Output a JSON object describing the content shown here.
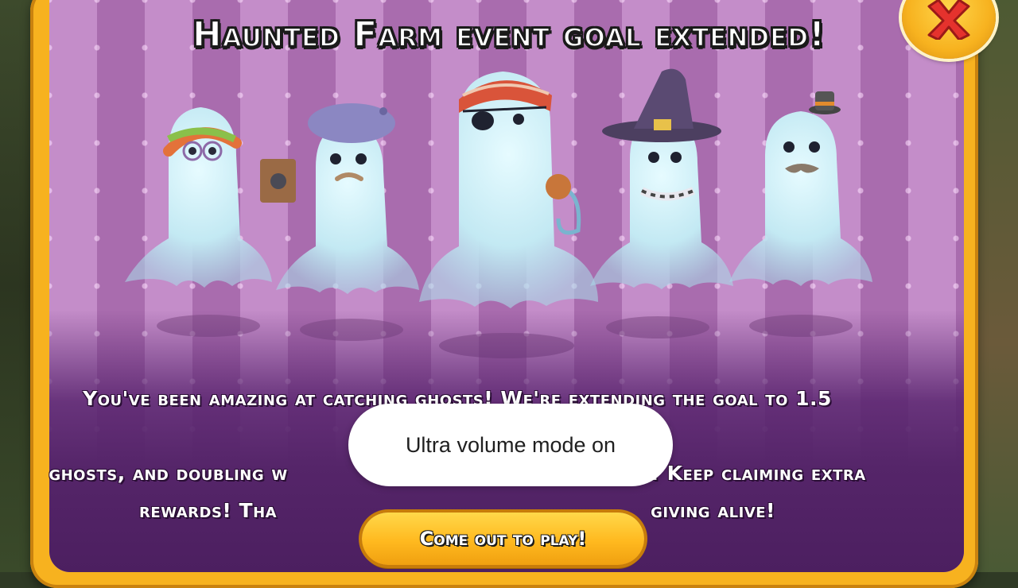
{
  "dialog": {
    "title": "Haunted Farm event goal extended!",
    "message": "You've been amazing at catching ghosts! We're extending the goal to 1.5 Billion ghosts, and doubling w... 00! Keep claiming extra rewards! Tha... giving alive!",
    "message_lines": [
      "You've been amazing at catching ghosts! We're extending the goal to 1.5 Billion",
      "ghosts, and doubling w",
      "00! Keep claiming extra",
      "rewards! Tha",
      "giving alive!"
    ],
    "cta_label": "Come out to play!",
    "close_icon": "close-x-icon"
  },
  "toast": {
    "text": "Ultra volume mode on"
  },
  "colors": {
    "frame": "#f7b21f",
    "panel_purple": "#b67bbd",
    "panel_dark": "#552569",
    "button_yellow": "#ffb91f",
    "close_red": "#e5322d",
    "ghost": "#c9edf5"
  }
}
